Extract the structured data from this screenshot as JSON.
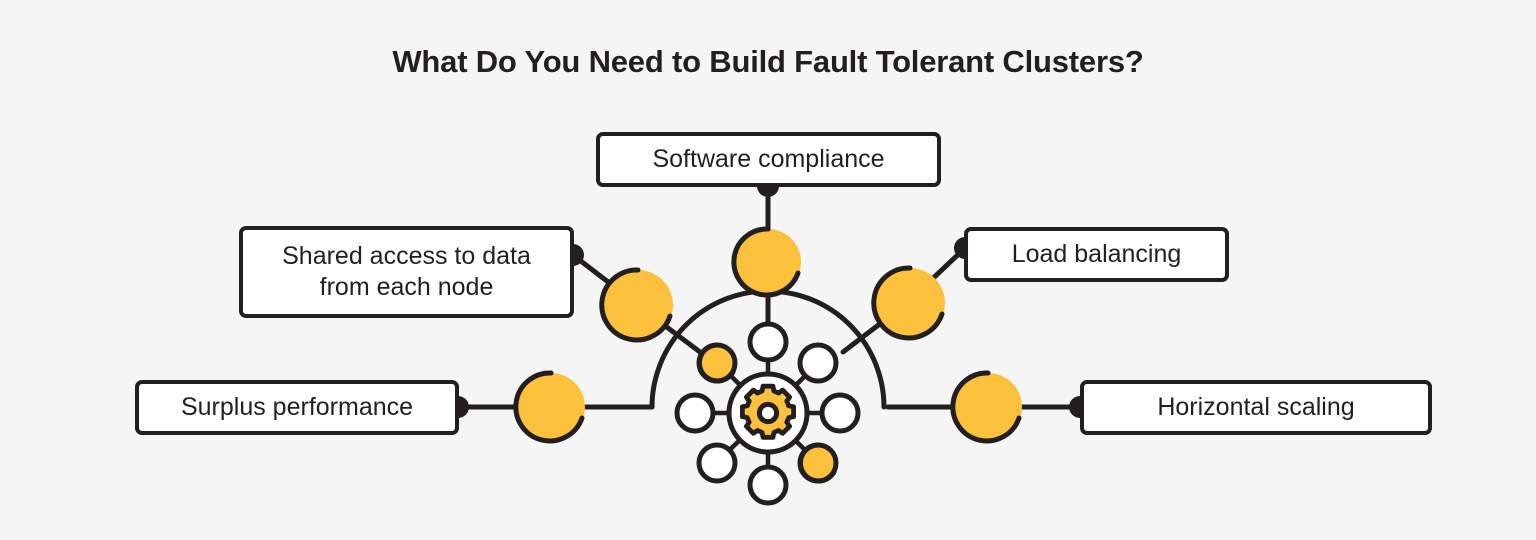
{
  "page": {
    "background_color": "#f5f5f5",
    "title": "What Do You Need to Build Fault Tolerant Clusters?",
    "title_color": "#231f20"
  },
  "theme": {
    "stroke_color": "#231f20",
    "accent_color": "#fbc13c",
    "node_fill": "#ffffff"
  },
  "hub": {
    "name": "cluster-hub",
    "center_icon": "gear-icon",
    "gear_color": "#fbc13c",
    "spoke_count": 8,
    "highlighted_spokes": [
      "north-west",
      "south-east"
    ]
  },
  "nodes": [
    {
      "id": "software-compliance",
      "label_line1": "Software compliance",
      "label_line2": "",
      "connector_side": "bottom"
    },
    {
      "id": "shared-access",
      "label_line1": "Shared access to data",
      "label_line2": "from each node",
      "connector_side": "right"
    },
    {
      "id": "load-balancing",
      "label_line1": "Load balancing",
      "label_line2": "",
      "connector_side": "left"
    },
    {
      "id": "surplus-performance",
      "label_line1": "Surplus performance",
      "label_line2": "",
      "connector_side": "right"
    },
    {
      "id": "horizontal-scaling",
      "label_line1": "Horizontal scaling",
      "label_line2": "",
      "connector_side": "left"
    }
  ]
}
